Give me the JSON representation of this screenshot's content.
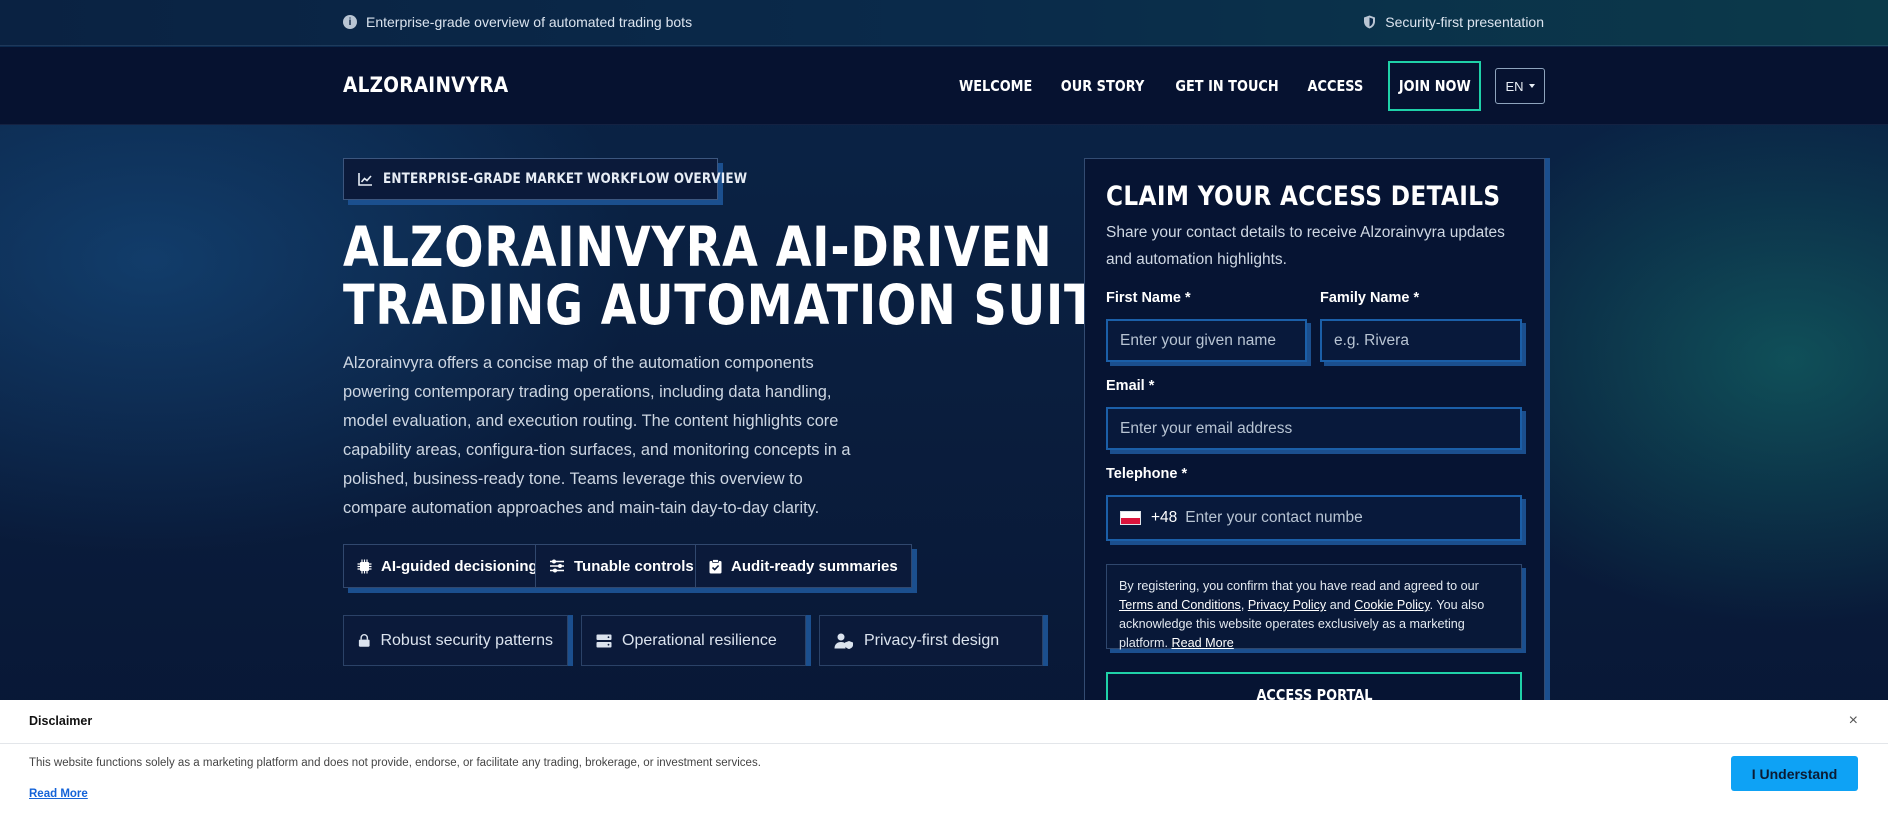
{
  "topbar": {
    "left_text": "Enterprise-grade overview of automated trading bots",
    "right_text": "Security-first presentation",
    "left_icon": "info-icon",
    "right_icon": "shield-icon"
  },
  "nav": {
    "logo": "ALZORAINVYRA",
    "links": [
      "WELCOME",
      "OUR STORY",
      "GET IN TOUCH",
      "ACCESS"
    ],
    "join": "JOIN NOW",
    "lang": "EN"
  },
  "hero": {
    "badge": "ENTERPRISE-GRADE MARKET WORKFLOW OVERVIEW",
    "title_line1": "ALZORAINVYRA AI-DRIVEN",
    "title_line2": "TRADING AUTOMATION SUITE",
    "description": "Alzorainvyra offers a concise map of the automation components powering contemporary trading operations, including data handling, model evaluation, and execution routing. The content highlights core capability areas, configura-tion surfaces, and monitoring concepts in a polished, business-ready tone. Teams leverage this overview to compare automation approaches and main-tain day-to-day clarity.",
    "chips": [
      "AI-guided decisioning",
      "Tunable controls",
      "Audit-ready summaries"
    ],
    "features": [
      "Robust security patterns",
      "Operational resilience",
      "Privacy-first design"
    ]
  },
  "form": {
    "title": "CLAIM YOUR ACCESS DETAILS",
    "subtitle": "Share your contact details to receive Alzorainvyra updates and automation highlights.",
    "first_name_label": "First Name *",
    "first_name_placeholder": "Enter your given name",
    "family_name_label": "Family Name *",
    "family_name_placeholder": "e.g. Rivera",
    "email_label": "Email *",
    "email_placeholder": "Enter your email address",
    "phone_label": "Telephone *",
    "phone_code": "+48",
    "phone_placeholder": "Enter your contact numbe",
    "consent_prefix": "By registering, you confirm that you have read and agreed to our ",
    "terms": "Terms and Conditions",
    "comma": ", ",
    "privacy": "Privacy Policy",
    "and": " and ",
    "cookie": "Cookie Policy",
    "consent_suffix": ". You also acknowledge this website operates exclusively as a marketing platform. ",
    "read_more": "Read More",
    "submit": "ACCESS PORTAL"
  },
  "disclaimer": {
    "title": "Disclaimer",
    "text": "This website functions solely as a marketing platform and does not provide, endorse, or facilitate any trading, brokerage, or investment services.",
    "read_more": "Read More",
    "button": "I Understand",
    "close": "×"
  },
  "colors": {
    "accent": "#1fd1a8",
    "input_border": "#1b5fa8",
    "shadow": "#1b4f8e",
    "disclaimer_button": "#0ea2f5"
  }
}
